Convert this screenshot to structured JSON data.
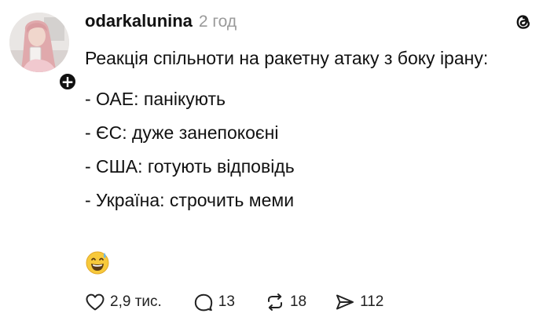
{
  "post": {
    "username": "odarkalunina",
    "timestamp": "2 год",
    "intro": "Реакція спільноти на ракетну атаку з боку ірану:",
    "reactions": [
      "- ОАЕ: панікують",
      "- ЄС: дуже занепокоєні",
      "- США: готують відповідь",
      "- Україна: строчить меми"
    ],
    "emoji": "grinning-face-with-sweat"
  },
  "actions": {
    "likes": "2,9 тис.",
    "comments": "13",
    "reposts": "18",
    "shares": "112"
  },
  "icons": {
    "like": "heart-icon",
    "comment": "speech-bubble-icon",
    "repost": "repost-icon",
    "share": "paper-plane-icon",
    "app": "threads-logo-icon",
    "follow": "plus-icon"
  },
  "colors": {
    "text": "#111111",
    "secondary": "#9a9a9a",
    "background": "#ffffff"
  }
}
